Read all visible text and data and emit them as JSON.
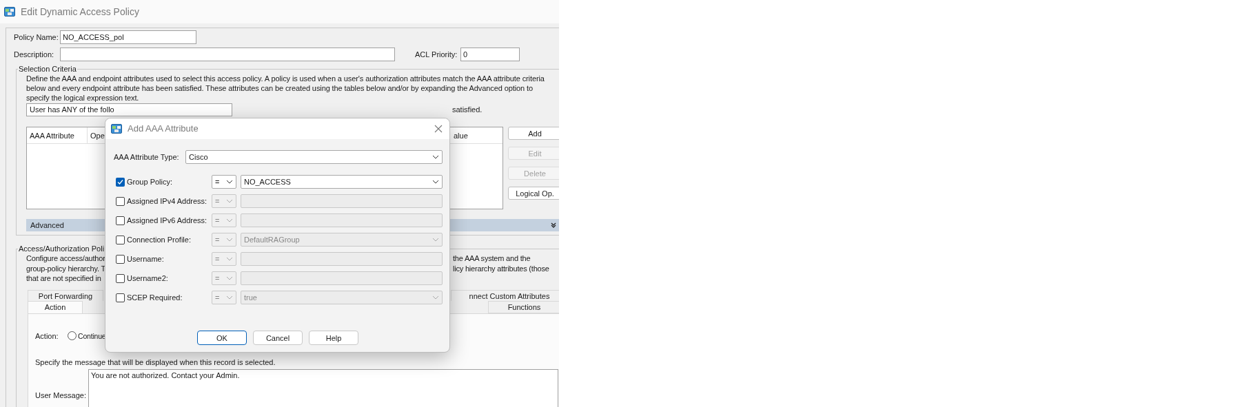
{
  "window": {
    "title": "Edit Dynamic Access Policy"
  },
  "policy_name": {
    "label": "Policy Name:",
    "value": "NO_ACCESS_pol"
  },
  "description": {
    "label": "Description:"
  },
  "acl_priority": {
    "label": "ACL Priority:",
    "value": "0"
  },
  "selection_criteria": {
    "title": "Selection Criteria",
    "text": "Define the AAA and endpoint attributes used to select this access policy. A policy is used when a user's authorization attributes match the AAA attribute criteria below and every endpoint attribute has been satisfied. These attributes can be created using the tables below and/or by expanding the Advanced option to specify the logical expression text.",
    "aaa_match": "User has ANY of the follo",
    "endpoint_match": "satisfied.",
    "table": {
      "columns": [
        "AAA Attribute",
        "Ope",
        "alue"
      ]
    },
    "buttons": [
      {
        "label": "Add",
        "disabled": false
      },
      {
        "label": "Edit",
        "disabled": true
      },
      {
        "label": "Delete",
        "disabled": true
      },
      {
        "label": "Logical Op.",
        "disabled": false
      }
    ],
    "advanced": {
      "label": "Advanced"
    }
  },
  "access_policy": {
    "title": "Access/Authorization Poli",
    "lines": [
      {
        "left": "Configure access/author",
        "right": "the AAA system and the"
      },
      {
        "left": "group-policy hierarchy. T",
        "right": "licy hierarchy attributes (those"
      },
      {
        "left": "that are not specified in"
      }
    ],
    "tabs_upper": [
      {
        "label": "Port Forwarding",
        "selected": false
      },
      {
        "label": "nnect Custom Attributes",
        "selected": false
      }
    ],
    "tabs_lower": [
      {
        "label": "Action",
        "selected": true
      },
      {
        "label": "Functions",
        "selected": false
      }
    ],
    "action": {
      "label": "Action:",
      "option": "Continue",
      "checked": false
    },
    "message_hint": "Specify the message that will be displayed when this record is selected.",
    "user_message": {
      "label": "User Message:",
      "value": "You are not authorized. Contact your Admin."
    }
  },
  "dialog": {
    "title": "Add AAA Attribute",
    "type": {
      "label": "AAA Attribute Type:",
      "value": "Cisco"
    },
    "rows": [
      {
        "label": "Group Policy:",
        "checked": true,
        "operator": "=",
        "kind": "select",
        "value": "NO_ACCESS"
      },
      {
        "label": "Assigned IPv4 Address:",
        "checked": false,
        "operator": "=",
        "kind": "text"
      },
      {
        "label": "Assigned IPv6 Address:",
        "checked": false,
        "operator": "=",
        "kind": "text"
      },
      {
        "label": "Connection Profile:",
        "checked": false,
        "operator": "=",
        "kind": "select",
        "value": "DefaultRAGroup"
      },
      {
        "label": "Username:",
        "checked": false,
        "operator": "=",
        "kind": "text"
      },
      {
        "label": "Username2:",
        "checked": false,
        "operator": "=",
        "kind": "text"
      },
      {
        "label": "SCEP Required:",
        "checked": false,
        "operator": "=",
        "kind": "select",
        "value": "true"
      }
    ],
    "buttons": [
      {
        "label": "OK",
        "default": true
      },
      {
        "label": "Cancel",
        "default": false
      },
      {
        "label": "Help",
        "default": false
      }
    ]
  }
}
